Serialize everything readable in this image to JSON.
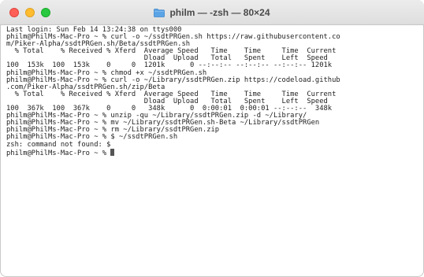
{
  "window": {
    "title": "philm — -zsh — 80×24",
    "traffic_lights": {
      "close_color": "#fe5f57",
      "minimize_color": "#febc2e",
      "zoom_color": "#28c840"
    },
    "title_icon": "folder-icon"
  },
  "terminal": {
    "lines": [
      "Last login: Sun Feb 14 13:24:38 on ttys000",
      "philm@PhilMs-Mac-Pro ~ % curl -o ~/ssdtPRGen.sh https://raw.githubusercontent.co",
      "m/Piker-Alpha/ssdtPRGen.sh/Beta/ssdtPRGen.sh",
      "  % Total    % Received % Xferd  Average Speed   Time    Time     Time  Current",
      "                                 Dload  Upload   Total   Spent    Left  Speed",
      "100  153k  100  153k    0     0  1201k      0 --:--:-- --:--:-- --:--:-- 1201k",
      "philm@PhilMs-Mac-Pro ~ % chmod +x ~/ssdtPRGen.sh",
      "philm@PhilMs-Mac-Pro ~ % curl -o ~/Library/ssdtPRGen.zip https://codeload.github",
      ".com/Piker-Alpha/ssdtPRGen.sh/zip/Beta",
      "  % Total    % Received % Xferd  Average Speed   Time    Time     Time  Current",
      "                                 Dload  Upload   Total   Spent    Left  Speed",
      "100  367k  100  367k    0     0   348k      0  0:00:01  0:00:01 --:--:--  348k",
      "philm@PhilMs-Mac-Pro ~ % unzip -qu ~/Library/ssdtPRGen.zip -d ~/Library/",
      "philm@PhilMs-Mac-Pro ~ % mv ~/Library/ssdtPRGen.sh-Beta ~/Library/ssdtPRGen",
      "philm@PhilMs-Mac-Pro ~ % rm ~/Library/ssdtPRGen.zip",
      "philm@PhilMs-Mac-Pro ~ % $ ~/ssdtPRGen.sh",
      "zsh: command not found: $"
    ],
    "prompt": "philm@PhilMs-Mac-Pro ~ % "
  }
}
